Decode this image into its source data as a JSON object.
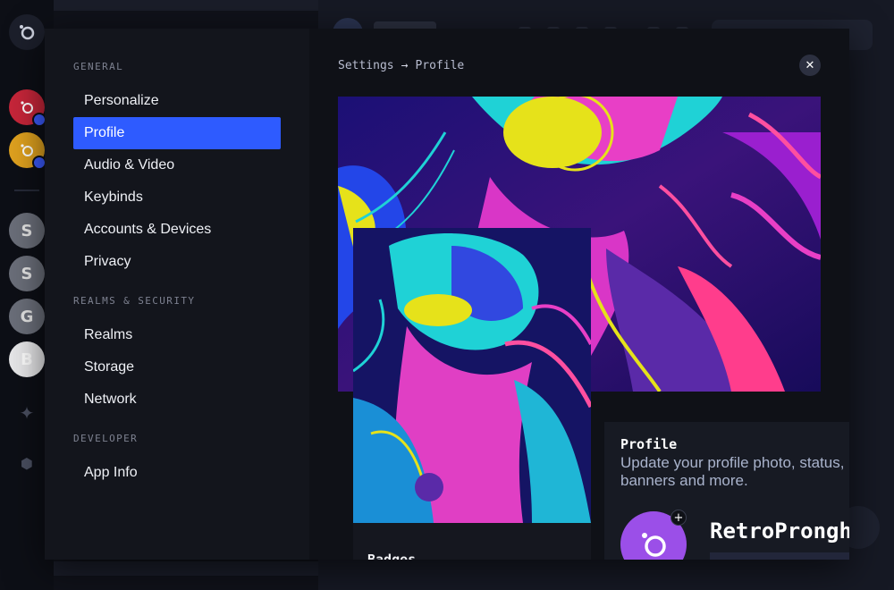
{
  "settings": {
    "nav": {
      "sections": [
        {
          "label": "GENERAL",
          "items": [
            {
              "label": "Personalize"
            },
            {
              "label": "Profile",
              "active": true
            },
            {
              "label": "Audio & Video"
            },
            {
              "label": "Keybinds"
            },
            {
              "label": "Accounts & Devices"
            },
            {
              "label": "Privacy"
            }
          ]
        },
        {
          "label": "REALMS & SECURITY",
          "items": [
            {
              "label": "Realms"
            },
            {
              "label": "Storage"
            },
            {
              "label": "Network"
            }
          ]
        },
        {
          "label": "DEVELOPER",
          "items": [
            {
              "label": "App Info"
            }
          ]
        }
      ]
    },
    "breadcrumb": {
      "root": "Settings",
      "separator": "→",
      "current": "Profile"
    },
    "close_icon": "close-icon",
    "preview": {
      "badges_label": "Badges"
    },
    "profile_panel": {
      "title": "Profile",
      "description_line1": "Update your profile photo, status,",
      "description_line2": "banners and more.",
      "display_name": "RetroPronghorn"
    }
  },
  "rail": {
    "servers": [
      {
        "letter": "S"
      },
      {
        "letter": "S"
      },
      {
        "letter": "G"
      },
      {
        "letter": "B"
      }
    ]
  },
  "colors": {
    "accent": "#2e5bff",
    "avatar": "#9b4fe8",
    "modal_bg": "#11131b"
  }
}
